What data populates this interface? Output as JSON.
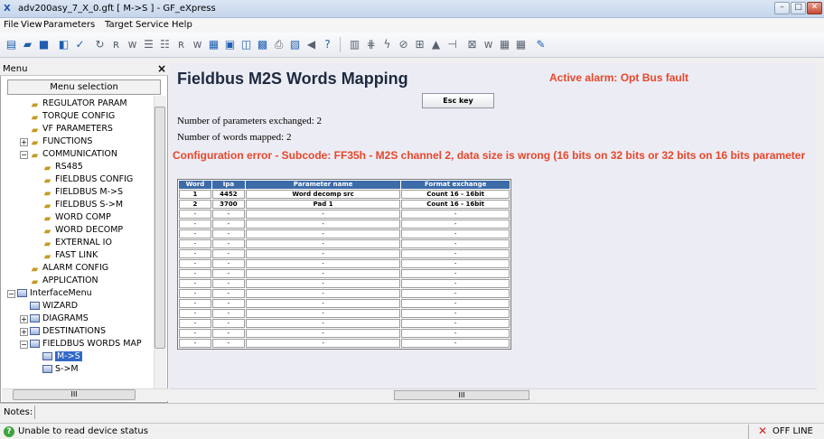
{
  "window": {
    "title": "adv200asy_7_X_0.gft [ M->S ] - GF_eXpress",
    "app_icon": "X"
  },
  "window_buttons": {
    "minimize": "–",
    "maximize": "□",
    "close": "✕"
  },
  "menubar": [
    "File",
    "View",
    "Parameters",
    "Target",
    "Service",
    "Help"
  ],
  "left_pane": {
    "label": "Menu",
    "close": "×",
    "selection_button": "Menu selection",
    "tree": [
      {
        "label": "REGULATOR PARAM",
        "icon": "folder-icon",
        "indent": 1,
        "exp": ""
      },
      {
        "label": "TORQUE CONFIG",
        "icon": "folder-icon",
        "indent": 1,
        "exp": ""
      },
      {
        "label": "VF PARAMETERS",
        "icon": "folder-icon",
        "indent": 1,
        "exp": ""
      },
      {
        "label": "FUNCTIONS",
        "icon": "folder-icon",
        "indent": 1,
        "exp": "+"
      },
      {
        "label": "COMMUNICATION",
        "icon": "folder-icon",
        "indent": 1,
        "exp": "−"
      },
      {
        "label": "RS485",
        "icon": "folder-icon",
        "indent": 2,
        "exp": ""
      },
      {
        "label": "FIELDBUS CONFIG",
        "icon": "folder-icon",
        "indent": 2,
        "exp": ""
      },
      {
        "label": "FIELDBUS M->S",
        "icon": "folder-icon",
        "indent": 2,
        "exp": ""
      },
      {
        "label": "FIELDBUS S->M",
        "icon": "folder-icon",
        "indent": 2,
        "exp": ""
      },
      {
        "label": "WORD COMP",
        "icon": "folder-icon",
        "indent": 2,
        "exp": ""
      },
      {
        "label": "WORD DECOMP",
        "icon": "folder-icon",
        "indent": 2,
        "exp": ""
      },
      {
        "label": "EXTERNAL IO",
        "icon": "folder-icon",
        "indent": 2,
        "exp": ""
      },
      {
        "label": "FAST LINK",
        "icon": "folder-icon",
        "indent": 2,
        "exp": ""
      },
      {
        "label": "ALARM CONFIG",
        "icon": "folder-icon",
        "indent": 1,
        "exp": ""
      },
      {
        "label": "APPLICATION",
        "icon": "folder-icon",
        "indent": 1,
        "exp": ""
      },
      {
        "label": "InterfaceMenu",
        "icon": "menu-icon",
        "indent": 0,
        "exp": "−"
      },
      {
        "label": "WIZARD",
        "icon": "menu-icon",
        "indent": 1,
        "exp": ""
      },
      {
        "label": "DIAGRAMS",
        "icon": "menu-icon",
        "indent": 1,
        "exp": "+"
      },
      {
        "label": "DESTINATIONS",
        "icon": "menu-icon",
        "indent": 1,
        "exp": "+"
      },
      {
        "label": "FIELDBUS WORDS MAP",
        "icon": "menu-icon",
        "indent": 1,
        "exp": "−"
      },
      {
        "label": "M->S",
        "icon": "menu-icon",
        "indent": 2,
        "exp": "",
        "selected": true
      },
      {
        "label": "S->M",
        "icon": "menu-icon",
        "indent": 2,
        "exp": ""
      }
    ],
    "hscroll_thumb": "III"
  },
  "content": {
    "title": "Fieldbus M2S Words Mapping",
    "alarm": "Active alarm: Opt Bus fault",
    "esc_button": "Esc key",
    "params_exchanged": "Number of parameters exchanged: 2",
    "words_mapped": "Number of words mapped: 2",
    "config_error": "Configuration error - Subcode: FF35h - M2S channel 2, data size is wrong (16 bits on 32 bits or 32 bits on 16 bits parameter",
    "hscroll_thumb": "III"
  },
  "table": {
    "headers": [
      "Word",
      "Ipa",
      "Parameter name",
      "Format exchange"
    ],
    "rows": [
      [
        "1",
        "4452",
        "Word decomp src",
        "Count 16 - 16bit"
      ],
      [
        "2",
        "3700",
        "Pad 1",
        "Count 16 - 16bit"
      ],
      [
        "-",
        "-",
        "-",
        "-"
      ],
      [
        "-",
        "-",
        "-",
        "-"
      ],
      [
        "-",
        "-",
        "-",
        "-"
      ],
      [
        "-",
        "-",
        "-",
        "-"
      ],
      [
        "-",
        "-",
        "-",
        "-"
      ],
      [
        "-",
        "-",
        "-",
        "-"
      ],
      [
        "-",
        "-",
        "-",
        "-"
      ],
      [
        "-",
        "-",
        "-",
        "-"
      ],
      [
        "-",
        "-",
        "-",
        "-"
      ],
      [
        "-",
        "-",
        "-",
        "-"
      ],
      [
        "-",
        "-",
        "-",
        "-"
      ],
      [
        "-",
        "-",
        "-",
        "-"
      ],
      [
        "-",
        "-",
        "-",
        "-"
      ],
      [
        "-",
        "-",
        "-",
        "-"
      ]
    ]
  },
  "notes": {
    "label": "Notes:"
  },
  "status": {
    "text": "Unable to read device status",
    "offline": "OFF LINE",
    "help_icon": "?"
  }
}
